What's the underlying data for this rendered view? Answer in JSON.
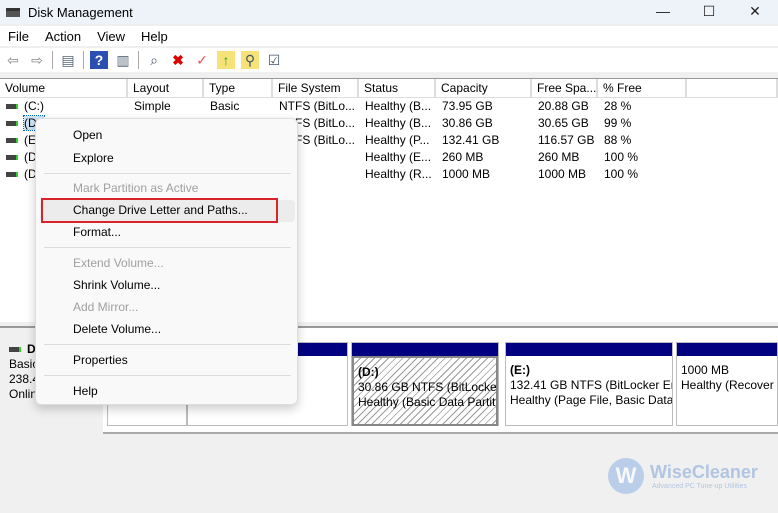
{
  "window": {
    "title": "Disk Management",
    "minimize": "—",
    "maximize": "☐",
    "close": "✕"
  },
  "menu": [
    "File",
    "Action",
    "View",
    "Help"
  ],
  "toolbar": {
    "icons": [
      "back-icon",
      "forward-icon",
      "console-tree-icon",
      "help-icon",
      "action-pane-icon",
      "connect-drive-icon",
      "delete-icon",
      "properties-icon",
      "up-folder-icon",
      "search-folder-icon",
      "checklist-icon"
    ]
  },
  "list": {
    "columns": [
      "Volume",
      "Layout",
      "Type",
      "File System",
      "Status",
      "Capacity",
      "Free Spa...",
      "% Free"
    ],
    "rows": [
      [
        "(C:)",
        "Simple",
        "Basic",
        "NTFS (BitLo...",
        "Healthy (B...",
        "73.95 GB",
        "20.88 GB",
        "28 %"
      ],
      [
        "(D:)",
        "Simple",
        "Basic",
        "NTFS (BitLo...",
        "Healthy (B...",
        "30.86 GB",
        "30.65 GB",
        "99 %"
      ],
      [
        "(E:)",
        "",
        "",
        "NTFS (BitLo...",
        "Healthy (P...",
        "132.41 GB",
        "116.57 GB",
        "88 %"
      ],
      [
        "(Di",
        "",
        "",
        "",
        "Healthy (E...",
        "260 MB",
        "260 MB",
        "100 %"
      ],
      [
        "(Di",
        "",
        "",
        "",
        "Healthy (R...",
        "1000 MB",
        "1000 MB",
        "100 %"
      ]
    ]
  },
  "disk": {
    "label": [
      "D",
      "Basic",
      "238.4",
      "Onlin"
    ],
    "partitions": [
      {
        "name": "",
        "line1": "",
        "line2": ""
      },
      {
        "name": "",
        "line1": "ocker Enc",
        "line2": "n Dump,"
      },
      {
        "name": "(D:)",
        "line1": "30.86 GB NTFS (BitLocker I",
        "line2": "Healthy (Basic Data Partiti"
      },
      {
        "name": "(E:)",
        "line1": "132.41 GB NTFS (BitLocker Enc",
        "line2": "Healthy (Page File, Basic Data"
      },
      {
        "name": "",
        "line1": "1000 MB",
        "line2": "Healthy (Recover"
      }
    ]
  },
  "context_menu": {
    "open": "Open",
    "explore": "Explore",
    "mark_active": "Mark Partition as Active",
    "change_letter": "Change Drive Letter and Paths...",
    "format": "Format...",
    "extend": "Extend Volume...",
    "shrink": "Shrink Volume...",
    "add_mirror": "Add Mirror...",
    "delete": "Delete Volume...",
    "properties": "Properties",
    "help": "Help"
  },
  "watermark": {
    "brand": "WiseCleaner",
    "tagline": "Advanced PC Tune-up Utilities",
    "logo_letter": "W"
  },
  "colors": {
    "partition_bar": "#000080",
    "highlight_box": "#d9232a"
  }
}
